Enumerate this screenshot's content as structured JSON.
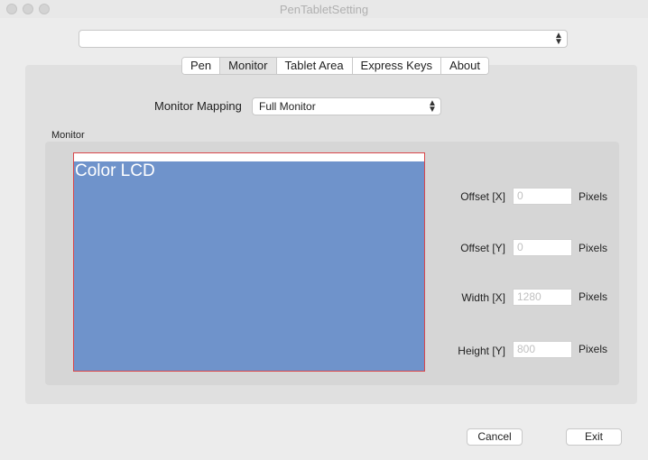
{
  "window": {
    "title": "PenTabletSetting"
  },
  "device_select": {
    "value": ""
  },
  "tabs": [
    {
      "label": "Pen"
    },
    {
      "label": "Monitor",
      "active": true
    },
    {
      "label": "Tablet Area"
    },
    {
      "label": "Express Keys"
    },
    {
      "label": "About"
    }
  ],
  "mapping": {
    "label": "Monitor Mapping",
    "value": "Full Monitor"
  },
  "monitor_group": {
    "label": "Monitor",
    "monitor_name": "Color LCD",
    "frame_color": "#d9464a",
    "screen_color": "#6f93cb"
  },
  "fields": {
    "offset_x": {
      "label": "Offset [X]",
      "value": "0",
      "unit": "Pixels"
    },
    "offset_y": {
      "label": "Offset [Y]",
      "value": "0",
      "unit": "Pixels"
    },
    "width_x": {
      "label": "Width [X]",
      "value": "1280",
      "unit": "Pixels"
    },
    "height_y": {
      "label": "Height [Y]",
      "value": "800",
      "unit": "Pixels"
    }
  },
  "buttons": {
    "cancel": "Cancel",
    "exit": "Exit"
  }
}
